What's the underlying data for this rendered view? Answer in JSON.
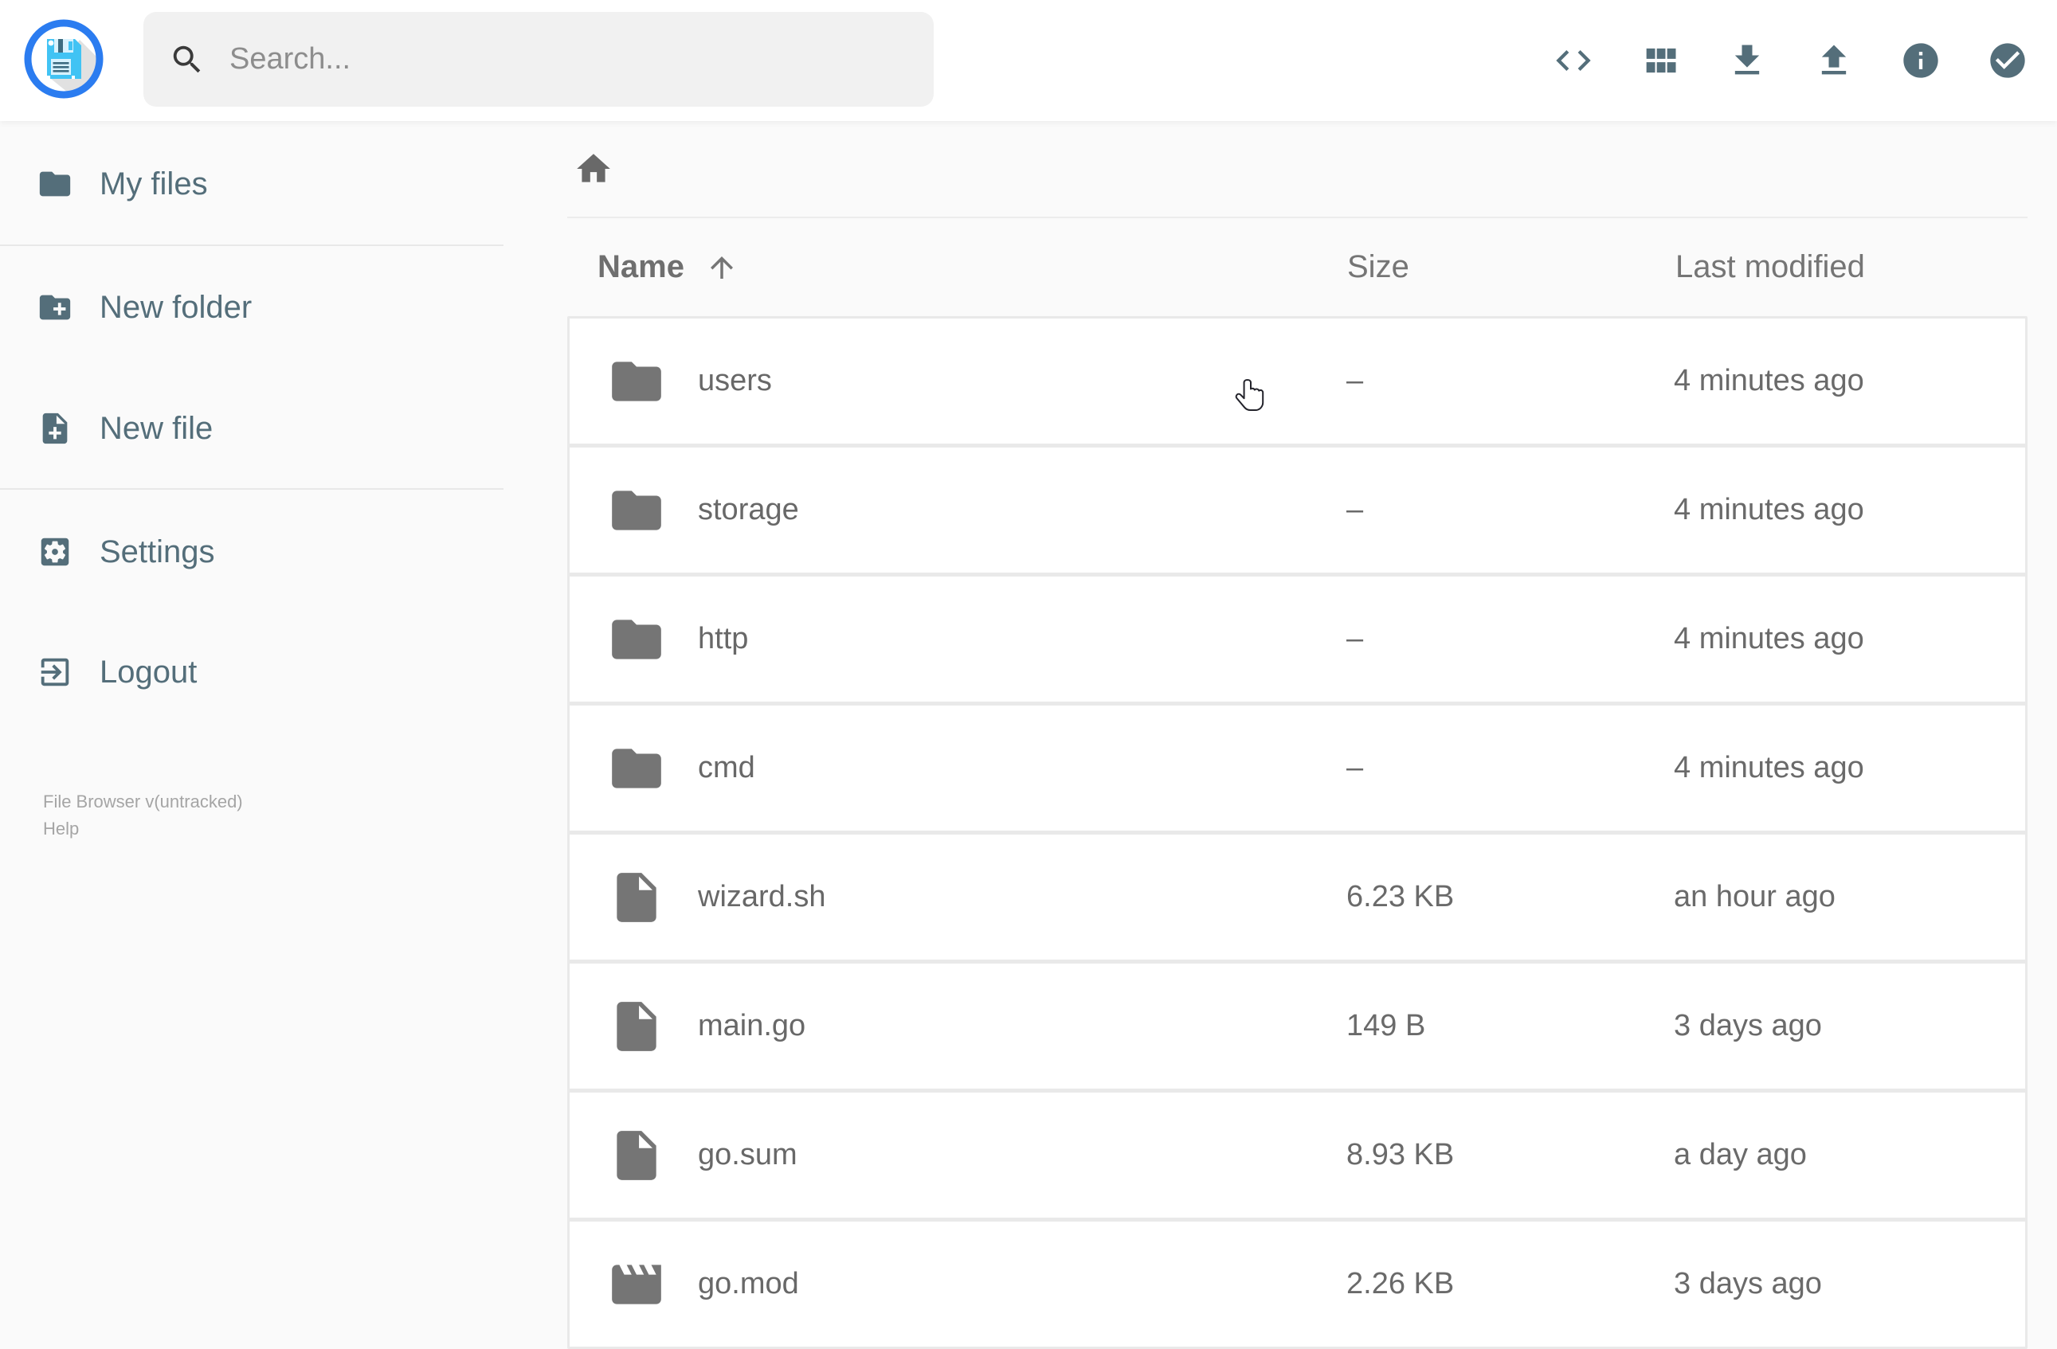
{
  "app": {
    "name": "File Browser"
  },
  "colors": {
    "accent": "#546e7a",
    "logo_ring_blue": "#2b7cf0",
    "logo_floppy_cyan": "#41c3f4",
    "row_icon_gray": "#757575",
    "row_text_gray": "#686868",
    "background": "#fafafa",
    "row_border": "#e9e9e9",
    "search_bg": "#f1f1f1"
  },
  "header": {
    "logo_icon": "floppy-disk-logo",
    "search": {
      "placeholder": "Search...",
      "value": "",
      "icon": "search-icon"
    },
    "actions": [
      {
        "name": "switch-view",
        "icon": "code-icon"
      },
      {
        "name": "grid-view",
        "icon": "grid-icon"
      },
      {
        "name": "download",
        "icon": "download-icon"
      },
      {
        "name": "upload",
        "icon": "upload-icon"
      },
      {
        "name": "info",
        "icon": "info-icon"
      },
      {
        "name": "select-multiple",
        "icon": "check-circle-icon"
      }
    ]
  },
  "sidebar": {
    "items": [
      {
        "label": "My files",
        "icon": "folder-icon"
      },
      {
        "label": "New folder",
        "icon": "new-folder-icon"
      },
      {
        "label": "New file",
        "icon": "new-file-icon"
      },
      {
        "label": "Settings",
        "icon": "settings-icon"
      },
      {
        "label": "Logout",
        "icon": "logout-icon"
      }
    ],
    "footer": {
      "version": "File Browser v(untracked)",
      "help": "Help"
    }
  },
  "main": {
    "breadcrumb": {
      "icon": "home-icon"
    },
    "table": {
      "headers": {
        "name": "Name",
        "size": "Size",
        "modified": "Last modified"
      },
      "sort": {
        "column": "name",
        "direction": "asc"
      }
    },
    "rows": [
      {
        "name": "users",
        "type": "folder",
        "size": "–",
        "modified": "4 minutes ago"
      },
      {
        "name": "storage",
        "type": "folder",
        "size": "–",
        "modified": "4 minutes ago"
      },
      {
        "name": "http",
        "type": "folder",
        "size": "–",
        "modified": "4 minutes ago"
      },
      {
        "name": "cmd",
        "type": "folder",
        "size": "–",
        "modified": "4 minutes ago"
      },
      {
        "name": "wizard.sh",
        "type": "file",
        "size": "6.23 KB",
        "modified": "an hour ago"
      },
      {
        "name": "main.go",
        "type": "file",
        "size": "149 B",
        "modified": "3 days ago"
      },
      {
        "name": "go.sum",
        "type": "file",
        "size": "8.93 KB",
        "modified": "a day ago"
      },
      {
        "name": "go.mod",
        "type": "video",
        "size": "2.26 KB",
        "modified": "3 days ago"
      }
    ]
  }
}
